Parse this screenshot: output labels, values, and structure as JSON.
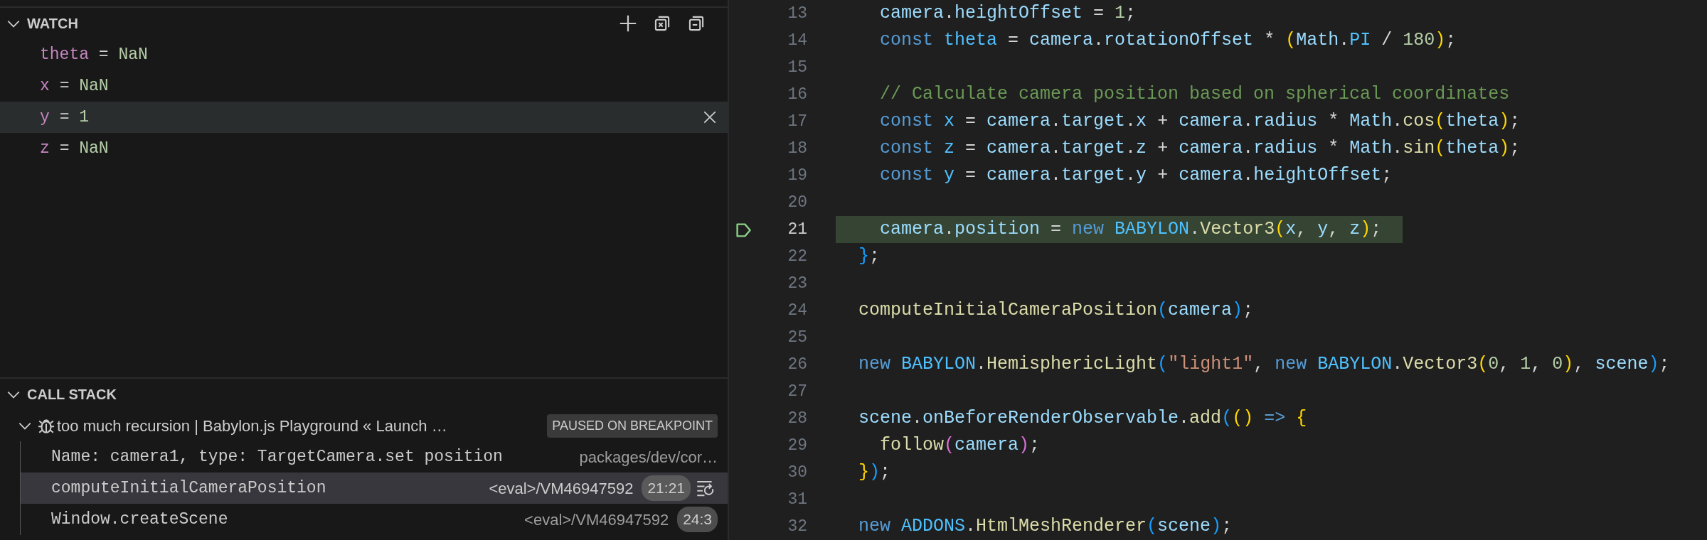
{
  "watch": {
    "title": "WATCH",
    "expanded": true,
    "expressions": [
      {
        "name": "theta",
        "operator": "=",
        "value": "NaN",
        "selected": false
      },
      {
        "name": "x",
        "operator": "=",
        "value": "NaN",
        "selected": false
      },
      {
        "name": "y",
        "operator": "=",
        "value": "1",
        "selected": true
      },
      {
        "name": "z",
        "operator": "=",
        "value": "NaN",
        "selected": false
      }
    ]
  },
  "call_stack": {
    "title": "CALL STACK",
    "expanded": true,
    "threads": [
      {
        "label": "too much recursion | Babylon.js Playground « Launch …",
        "status": "PAUSED ON BREAKPOINT",
        "expanded": true,
        "frames": [
          {
            "name": "Name: camera1, type: TargetCamera.set position",
            "source": "packages/dev/cor…",
            "selected": false
          },
          {
            "name": "computeInitialCameraPosition",
            "source": "<eval>/VM46947592",
            "position": "21:21",
            "selected": true
          },
          {
            "name": "Window.createScene",
            "source": "<eval>/VM46947592",
            "position": "24:3",
            "selected": false
          }
        ]
      }
    ]
  },
  "editor": {
    "lines": [
      {
        "number": "13",
        "current": false,
        "indent": true,
        "tokens": [
          {
            "kind": "var",
            "text": "camera"
          },
          {
            "kind": "plain",
            "text": "."
          },
          {
            "kind": "var",
            "text": "heightOffset"
          },
          {
            "kind": "plain",
            "text": " = "
          },
          {
            "kind": "num",
            "text": "1"
          },
          {
            "kind": "plain",
            "text": ";"
          }
        ]
      },
      {
        "number": "14",
        "current": false,
        "indent": true,
        "tokens": [
          {
            "kind": "kw",
            "text": "const "
          },
          {
            "kind": "const",
            "text": "theta"
          },
          {
            "kind": "plain",
            "text": " = "
          },
          {
            "kind": "var",
            "text": "camera"
          },
          {
            "kind": "plain",
            "text": "."
          },
          {
            "kind": "var",
            "text": "rotationOffset"
          },
          {
            "kind": "plain",
            "text": " * "
          },
          {
            "kind": "b1",
            "text": "("
          },
          {
            "kind": "var",
            "text": "Math"
          },
          {
            "kind": "plain",
            "text": "."
          },
          {
            "kind": "const",
            "text": "PI"
          },
          {
            "kind": "plain",
            "text": " / "
          },
          {
            "kind": "num",
            "text": "180"
          },
          {
            "kind": "b1",
            "text": ")"
          },
          {
            "kind": "plain",
            "text": ";"
          }
        ]
      },
      {
        "number": "15",
        "current": false
      },
      {
        "number": "16",
        "current": false,
        "indent": true,
        "tokens": [
          {
            "kind": "comment",
            "text": "// Calculate camera position based on spherical coordinates"
          }
        ]
      },
      {
        "number": "17",
        "current": false,
        "indent": true,
        "tokens": [
          {
            "kind": "kw",
            "text": "const "
          },
          {
            "kind": "const",
            "text": "x"
          },
          {
            "kind": "plain",
            "text": " = "
          },
          {
            "kind": "var",
            "text": "camera"
          },
          {
            "kind": "plain",
            "text": "."
          },
          {
            "kind": "var",
            "text": "target"
          },
          {
            "kind": "plain",
            "text": "."
          },
          {
            "kind": "var",
            "text": "x"
          },
          {
            "kind": "plain",
            "text": " + "
          },
          {
            "kind": "var",
            "text": "camera"
          },
          {
            "kind": "plain",
            "text": "."
          },
          {
            "kind": "var",
            "text": "radius"
          },
          {
            "kind": "plain",
            "text": " * "
          },
          {
            "kind": "var",
            "text": "Math"
          },
          {
            "kind": "plain",
            "text": "."
          },
          {
            "kind": "func",
            "text": "cos"
          },
          {
            "kind": "b1",
            "text": "("
          },
          {
            "kind": "var",
            "text": "theta"
          },
          {
            "kind": "b1",
            "text": ")"
          },
          {
            "kind": "plain",
            "text": ";"
          }
        ]
      },
      {
        "number": "18",
        "current": false,
        "indent": true,
        "tokens": [
          {
            "kind": "kw",
            "text": "const "
          },
          {
            "kind": "const",
            "text": "z"
          },
          {
            "kind": "plain",
            "text": " = "
          },
          {
            "kind": "var",
            "text": "camera"
          },
          {
            "kind": "plain",
            "text": "."
          },
          {
            "kind": "var",
            "text": "target"
          },
          {
            "kind": "plain",
            "text": "."
          },
          {
            "kind": "var",
            "text": "z"
          },
          {
            "kind": "plain",
            "text": " + "
          },
          {
            "kind": "var",
            "text": "camera"
          },
          {
            "kind": "plain",
            "text": "."
          },
          {
            "kind": "var",
            "text": "radius"
          },
          {
            "kind": "plain",
            "text": " * "
          },
          {
            "kind": "var",
            "text": "Math"
          },
          {
            "kind": "plain",
            "text": "."
          },
          {
            "kind": "func",
            "text": "sin"
          },
          {
            "kind": "b1",
            "text": "("
          },
          {
            "kind": "var",
            "text": "theta"
          },
          {
            "kind": "b1",
            "text": ")"
          },
          {
            "kind": "plain",
            "text": ";"
          }
        ]
      },
      {
        "number": "19",
        "current": false,
        "indent": true,
        "tokens": [
          {
            "kind": "kw",
            "text": "const "
          },
          {
            "kind": "const",
            "text": "y"
          },
          {
            "kind": "plain",
            "text": " = "
          },
          {
            "kind": "var",
            "text": "camera"
          },
          {
            "kind": "plain",
            "text": "."
          },
          {
            "kind": "var",
            "text": "target"
          },
          {
            "kind": "plain",
            "text": "."
          },
          {
            "kind": "var",
            "text": "y"
          },
          {
            "kind": "plain",
            "text": " + "
          },
          {
            "kind": "var",
            "text": "camera"
          },
          {
            "kind": "plain",
            "text": "."
          },
          {
            "kind": "var",
            "text": "heightOffset"
          },
          {
            "kind": "plain",
            "text": ";"
          }
        ]
      },
      {
        "number": "20",
        "current": false
      },
      {
        "number": "21",
        "current": true,
        "indent": true,
        "tokens": [
          {
            "kind": "var",
            "text": "camera"
          },
          {
            "kind": "plain",
            "text": "."
          },
          {
            "kind": "var",
            "text": "position"
          },
          {
            "kind": "plain",
            "text": " = "
          },
          {
            "kind": "kw",
            "text": "new "
          },
          {
            "kind": "const",
            "text": "BABYLON"
          },
          {
            "kind": "plain",
            "text": "."
          },
          {
            "kind": "func",
            "text": "Vector3"
          },
          {
            "kind": "b1",
            "text": "("
          },
          {
            "kind": "var",
            "text": "x"
          },
          {
            "kind": "plain",
            "text": ", "
          },
          {
            "kind": "var",
            "text": "y"
          },
          {
            "kind": "plain",
            "text": ", "
          },
          {
            "kind": "var",
            "text": "z"
          },
          {
            "kind": "b1",
            "text": ")"
          },
          {
            "kind": "plain",
            "text": ";"
          }
        ]
      },
      {
        "number": "22",
        "current": false,
        "indent": false,
        "tokens": [
          {
            "kind": "b3",
            "text": "}"
          },
          {
            "kind": "plain",
            "text": ";"
          }
        ]
      },
      {
        "number": "23",
        "current": false
      },
      {
        "number": "24",
        "current": false,
        "indent": false,
        "tokens": [
          {
            "kind": "func",
            "text": "computeInitialCameraPosition"
          },
          {
            "kind": "b3",
            "text": "("
          },
          {
            "kind": "var",
            "text": "camera"
          },
          {
            "kind": "b3",
            "text": ")"
          },
          {
            "kind": "plain",
            "text": ";"
          }
        ]
      },
      {
        "number": "25",
        "current": false
      },
      {
        "number": "26",
        "current": false,
        "indent": false,
        "tokens": [
          {
            "kind": "kw",
            "text": "new "
          },
          {
            "kind": "const",
            "text": "BABYLON"
          },
          {
            "kind": "plain",
            "text": "."
          },
          {
            "kind": "func",
            "text": "HemisphericLight"
          },
          {
            "kind": "b3",
            "text": "("
          },
          {
            "kind": "str",
            "text": "\"light1\""
          },
          {
            "kind": "plain",
            "text": ", "
          },
          {
            "kind": "kw",
            "text": "new "
          },
          {
            "kind": "const",
            "text": "BABYLON"
          },
          {
            "kind": "plain",
            "text": "."
          },
          {
            "kind": "func",
            "text": "Vector3"
          },
          {
            "kind": "b1",
            "text": "("
          },
          {
            "kind": "num",
            "text": "0"
          },
          {
            "kind": "plain",
            "text": ", "
          },
          {
            "kind": "num",
            "text": "1"
          },
          {
            "kind": "plain",
            "text": ", "
          },
          {
            "kind": "num",
            "text": "0"
          },
          {
            "kind": "b1",
            "text": ")"
          },
          {
            "kind": "plain",
            "text": ", "
          },
          {
            "kind": "var",
            "text": "scene"
          },
          {
            "kind": "b3",
            "text": ")"
          },
          {
            "kind": "plain",
            "text": ";"
          }
        ]
      },
      {
        "number": "27",
        "current": false
      },
      {
        "number": "28",
        "current": false,
        "indent": false,
        "tokens": [
          {
            "kind": "var",
            "text": "scene"
          },
          {
            "kind": "plain",
            "text": "."
          },
          {
            "kind": "var",
            "text": "onBeforeRenderObservable"
          },
          {
            "kind": "plain",
            "text": "."
          },
          {
            "kind": "func",
            "text": "add"
          },
          {
            "kind": "b3",
            "text": "("
          },
          {
            "kind": "b1",
            "text": "()"
          },
          {
            "kind": "kw",
            "text": " => "
          },
          {
            "kind": "b1",
            "text": "{"
          }
        ]
      },
      {
        "number": "29",
        "current": false,
        "indent": true,
        "tokens": [
          {
            "kind": "func",
            "text": "follow"
          },
          {
            "kind": "b2",
            "text": "("
          },
          {
            "kind": "var",
            "text": "camera"
          },
          {
            "kind": "b2",
            "text": ")"
          },
          {
            "kind": "plain",
            "text": ";"
          }
        ]
      },
      {
        "number": "30",
        "current": false,
        "indent": false,
        "tokens": [
          {
            "kind": "b1",
            "text": "}"
          },
          {
            "kind": "b3",
            "text": ")"
          },
          {
            "kind": "plain",
            "text": ";"
          }
        ]
      },
      {
        "number": "31",
        "current": false
      },
      {
        "number": "32",
        "current": false,
        "indent": false,
        "tokens": [
          {
            "kind": "kw",
            "text": "new "
          },
          {
            "kind": "const",
            "text": "ADDONS"
          },
          {
            "kind": "plain",
            "text": "."
          },
          {
            "kind": "func",
            "text": "HtmlMeshRenderer"
          },
          {
            "kind": "b3",
            "text": "("
          },
          {
            "kind": "var",
            "text": "scene"
          },
          {
            "kind": "b3",
            "text": ")"
          },
          {
            "kind": "plain",
            "text": ";"
          }
        ]
      }
    ]
  }
}
